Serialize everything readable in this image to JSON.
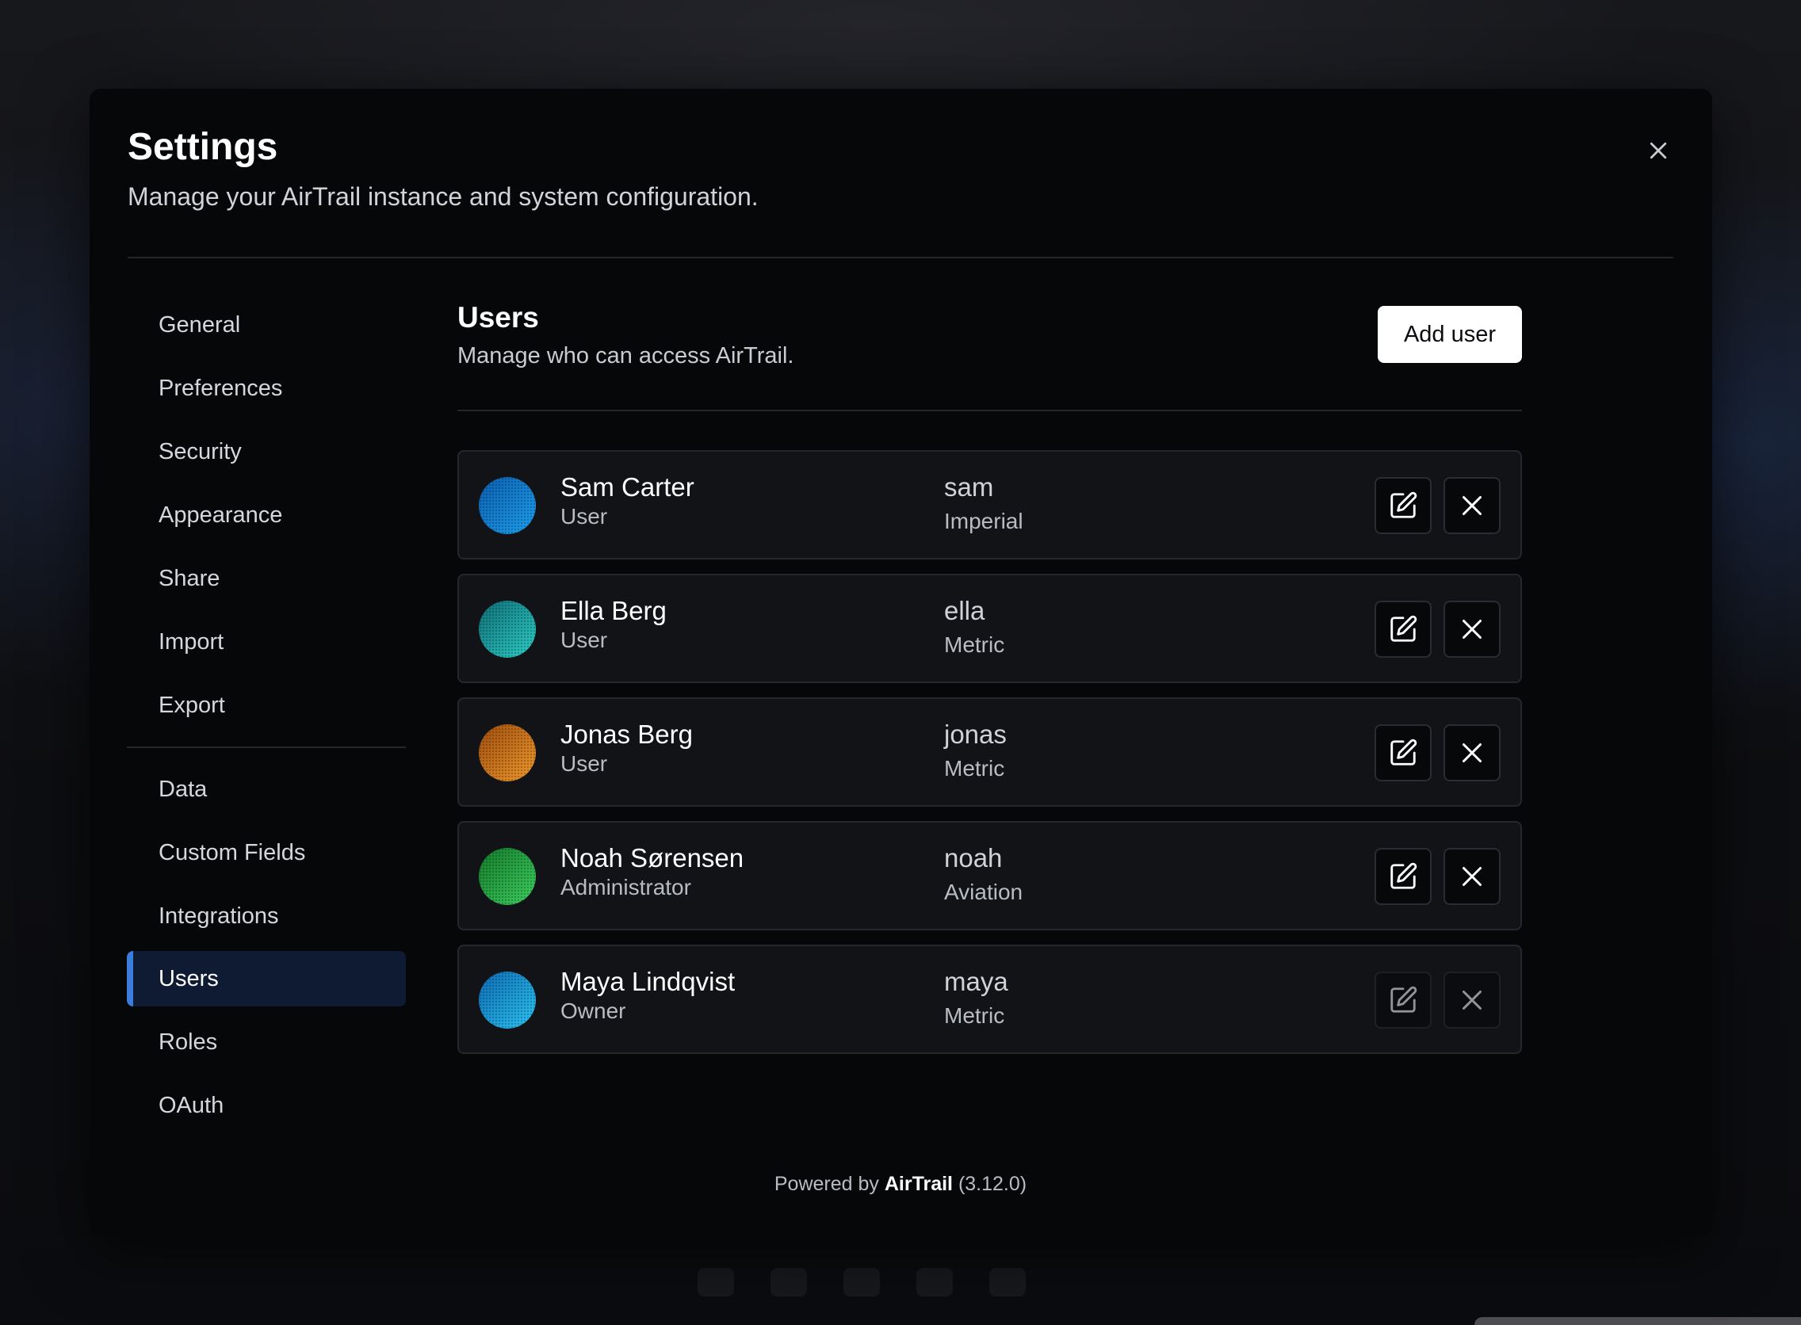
{
  "modal": {
    "title": "Settings",
    "subtitle": "Manage your AirTrail instance and system configuration."
  },
  "sidebar": {
    "items": [
      {
        "label": "General"
      },
      {
        "label": "Preferences"
      },
      {
        "label": "Security"
      },
      {
        "label": "Appearance"
      },
      {
        "label": "Share"
      },
      {
        "label": "Import"
      },
      {
        "label": "Export"
      },
      {
        "label": "Data"
      },
      {
        "label": "Custom Fields"
      },
      {
        "label": "Integrations"
      },
      {
        "label": "Users",
        "active": true
      },
      {
        "label": "Roles"
      },
      {
        "label": "OAuth"
      }
    ]
  },
  "users_section": {
    "title": "Users",
    "subtitle": "Manage who can access AirTrail.",
    "add_button": "Add user",
    "users": [
      {
        "name": "Sam Carter",
        "role": "User",
        "username": "sam",
        "units": "Imperial",
        "avatar_colors": [
          "#0a5fb0",
          "#1ea0f0"
        ],
        "actions_enabled": true
      },
      {
        "name": "Ella Berg",
        "role": "User",
        "username": "ella",
        "units": "Metric",
        "avatar_colors": [
          "#0f6e78",
          "#2ed0c8"
        ],
        "actions_enabled": true
      },
      {
        "name": "Jonas Berg",
        "role": "User",
        "username": "jonas",
        "units": "Metric",
        "avatar_colors": [
          "#a04e0c",
          "#f29a2e"
        ],
        "actions_enabled": true
      },
      {
        "name": "Noah Sørensen",
        "role": "Administrator",
        "username": "noah",
        "units": "Aviation",
        "avatar_colors": [
          "#137a2a",
          "#3fd160"
        ],
        "actions_enabled": true
      },
      {
        "name": "Maya Lindqvist",
        "role": "Owner",
        "username": "maya",
        "units": "Metric",
        "avatar_colors": [
          "#0b6bb5",
          "#2ec6f5"
        ],
        "actions_enabled": false
      }
    ]
  },
  "footer": {
    "prefix": "Powered by",
    "brand": "AirTrail",
    "version": "(3.12.0)"
  },
  "icons": {
    "close": "close-icon",
    "edit": "edit-icon",
    "delete": "delete-icon"
  }
}
